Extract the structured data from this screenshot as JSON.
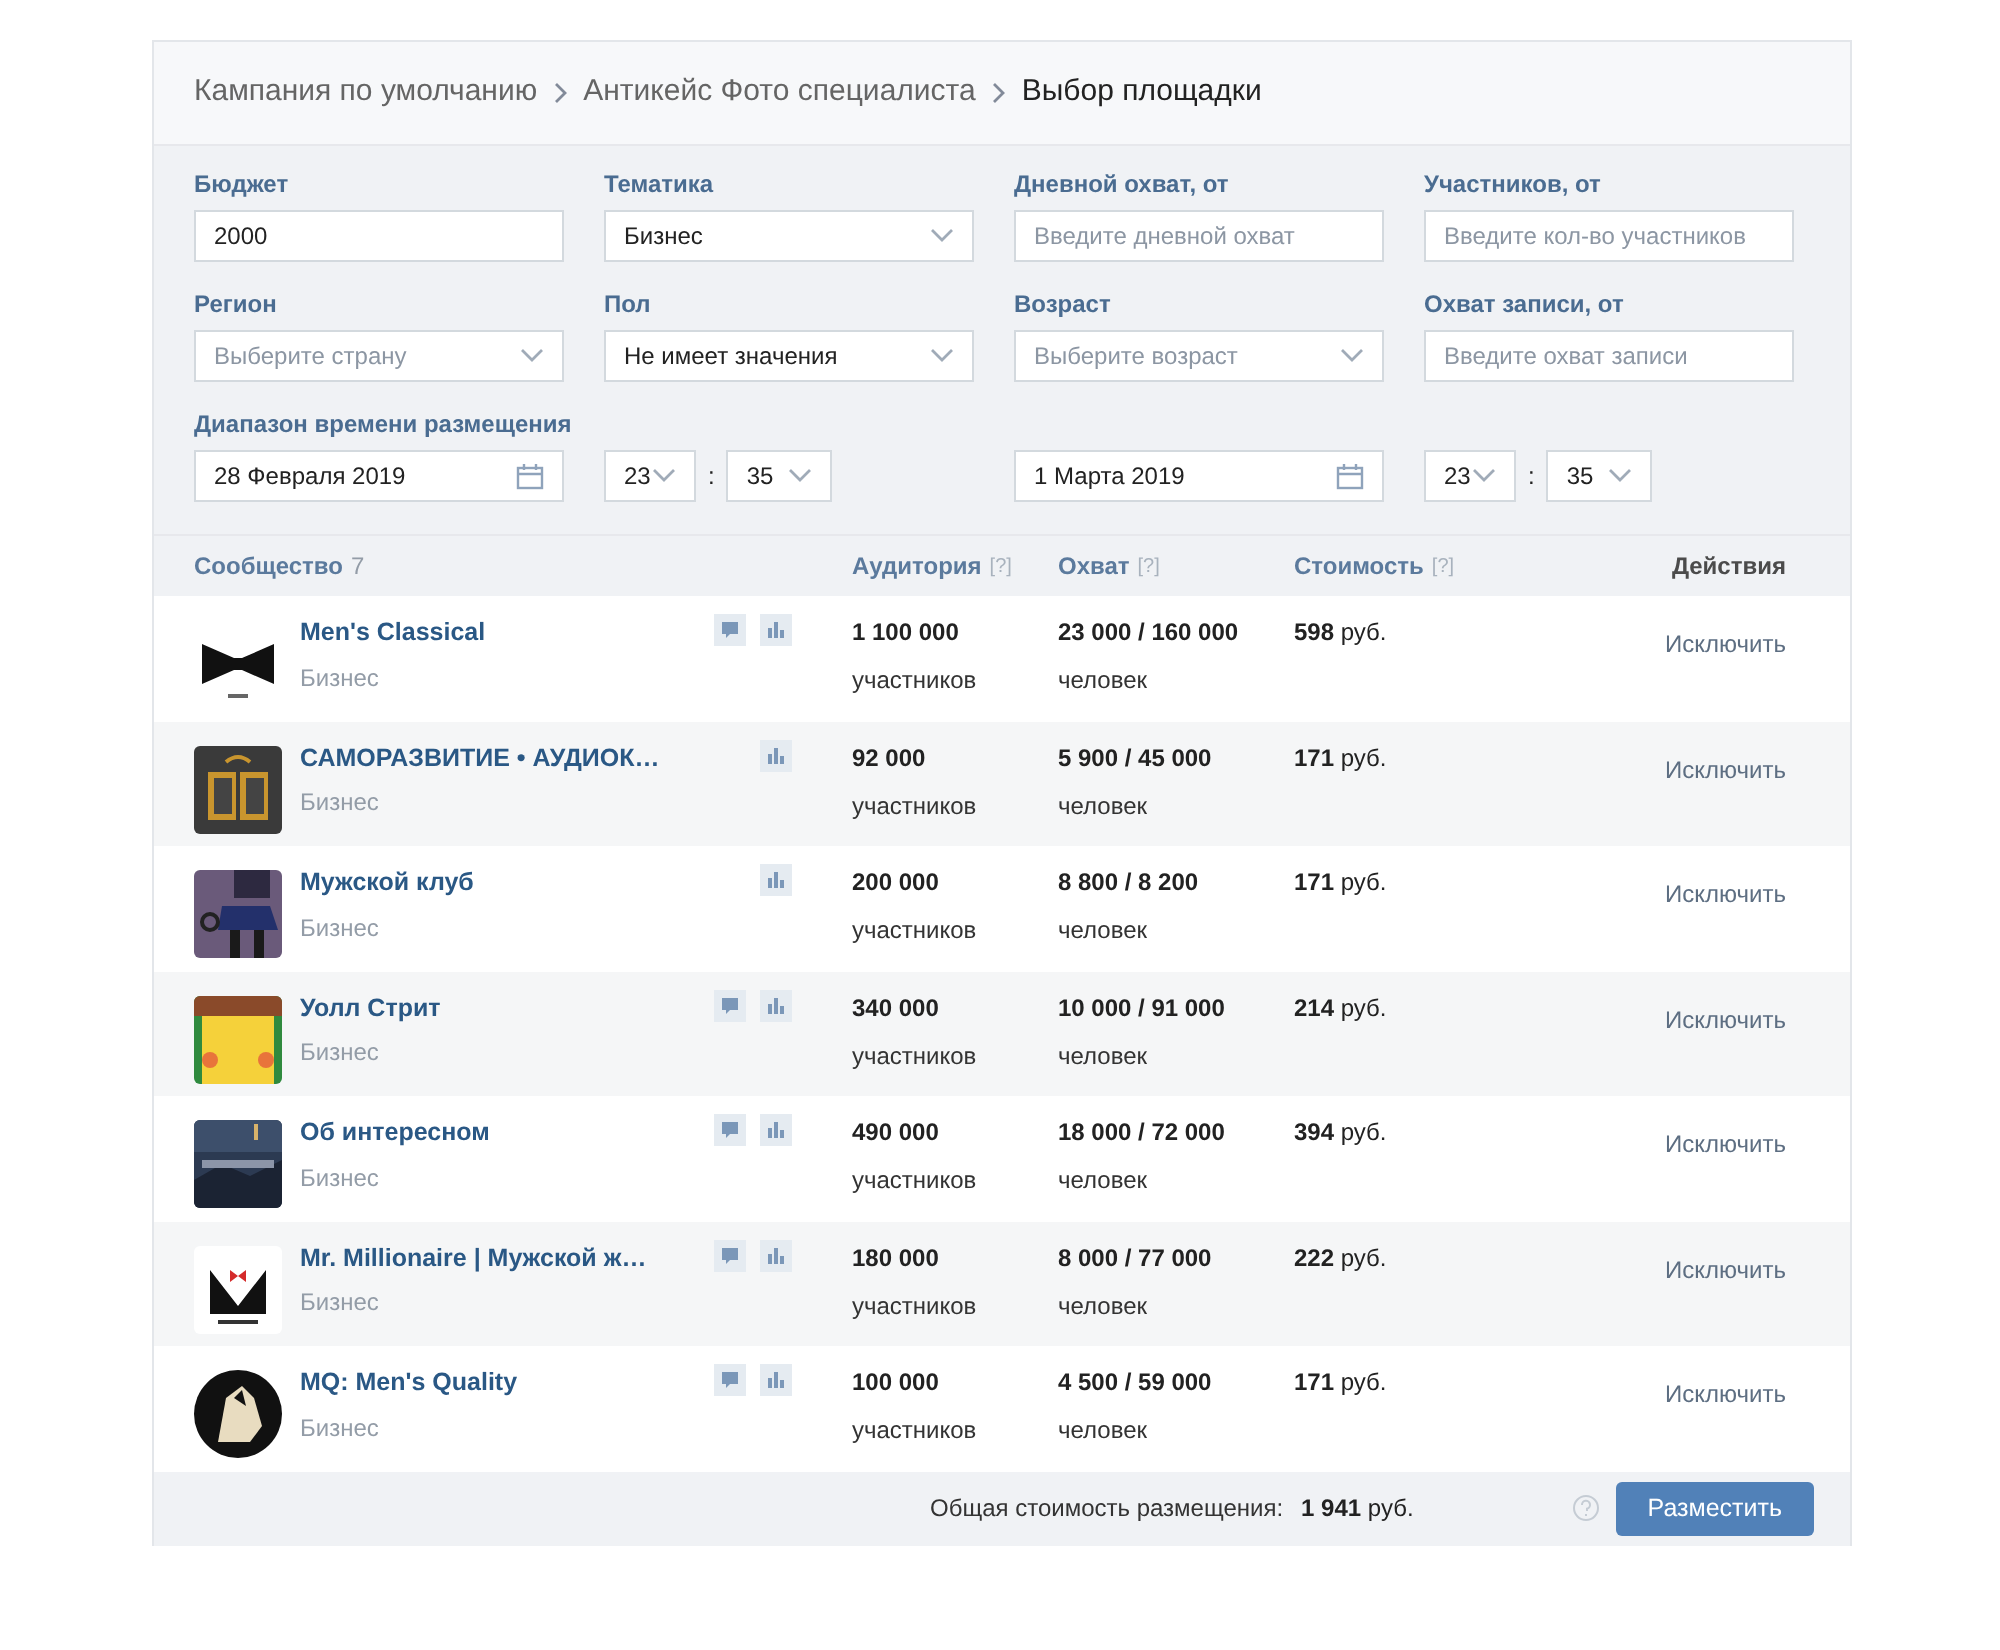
{
  "breadcrumbs": [
    {
      "label": "Кампания по умолчанию",
      "current": false
    },
    {
      "label": "Антикейс Фото специалиста",
      "current": false
    },
    {
      "label": "Выбор площадки",
      "current": true
    }
  ],
  "filters": [
    {
      "label": "Бюджет",
      "kind": "text",
      "value": "2000"
    },
    {
      "label": "Тематика",
      "kind": "select",
      "value": "Бизнес"
    },
    {
      "label": "Дневной охват, от",
      "kind": "text",
      "placeholder": "Введите дневной охват"
    },
    {
      "label": "Участников, от",
      "kind": "text",
      "placeholder": "Введите кол-во участников"
    },
    {
      "label": "Регион",
      "kind": "select",
      "placeholder": "Выберите страну"
    },
    {
      "label": "Пол",
      "kind": "select",
      "value": "Не имеет значения"
    },
    {
      "label": "Возраст",
      "kind": "select",
      "placeholder": "Выберите возраст"
    },
    {
      "label": "Охват записи, от",
      "kind": "text",
      "placeholder": "Введите охват записи"
    }
  ],
  "time_range": {
    "label": "Диапазон времени размещения",
    "start": {
      "date": "28 Февраля 2019",
      "hour": "23",
      "separator": ":",
      "minute": "35"
    },
    "end": {
      "date": "1 Марта 2019",
      "hour": "23",
      "separator": ":",
      "minute": "35"
    }
  },
  "table": {
    "columns": [
      {
        "label": "Сообщество",
        "count": "7"
      },
      {
        "label": "Аудитория",
        "help": "[?]"
      },
      {
        "label": "Охват",
        "help": "[?]"
      },
      {
        "label": "Стоимость",
        "help": "[?]"
      },
      {
        "label": "Действия"
      }
    ],
    "rows": [
      {
        "name": "Men's Classical",
        "topic": "Бизнес",
        "has_comments": true,
        "audience": "1 100 000",
        "audience_unit": "участников",
        "reach": "23 000 / 160 000",
        "reach_unit": "человек",
        "cost": "**598** руб.",
        "action": "Исключить"
      },
      {
        "name": "САМОРАЗВИТИЕ • АУДИОК…",
        "topic": "Бизнес",
        "has_comments": false,
        "audience": "92 000",
        "audience_unit": "участников",
        "reach": "5 900 / 45 000",
        "reach_unit": "человек",
        "cost": "**171** руб.",
        "action": "Исключить"
      },
      {
        "name": "Мужской клуб",
        "topic": "Бизнес",
        "has_comments": false,
        "audience": "200 000",
        "audience_unit": "участников",
        "reach": "8 800 / 8 200",
        "reach_unit": "человек",
        "cost": "**171** руб.",
        "action": "Исключить"
      },
      {
        "name": "Уолл Стрит",
        "topic": "Бизнес",
        "has_comments": true,
        "audience": "340 000",
        "audience_unit": "участников",
        "reach": "10 000 / 91 000",
        "reach_unit": "человек",
        "cost": "**214** руб.",
        "action": "Исключить"
      },
      {
        "name": "Об интересном",
        "topic": "Бизнес",
        "has_comments": true,
        "audience": "490 000",
        "audience_unit": "участников",
        "reach": "18 000 / 72 000",
        "reach_unit": "человек",
        "cost": "**394** руб.",
        "action": "Исключить"
      },
      {
        "name": "Mr. Millionaire | Мужской ж…",
        "topic": "Бизнес",
        "has_comments": true,
        "audience": "180 000",
        "audience_unit": "участников",
        "reach": "8 000 / 77 000",
        "reach_unit": "человек",
        "cost": "**222** руб.",
        "action": "Исключить"
      },
      {
        "name": "MQ: Men's Quality",
        "topic": "Бизнес",
        "has_comments": true,
        "audience": "100 000",
        "audience_unit": "участников",
        "reach": "4 500 / 59 000",
        "reach_unit": "человек",
        "cost": "**171** руб.",
        "action": "Исключить"
      }
    ]
  },
  "footer": {
    "total_label": "Общая стоимость размещения:",
    "total": "**1 941** руб.",
    "button": "Разместить"
  }
}
